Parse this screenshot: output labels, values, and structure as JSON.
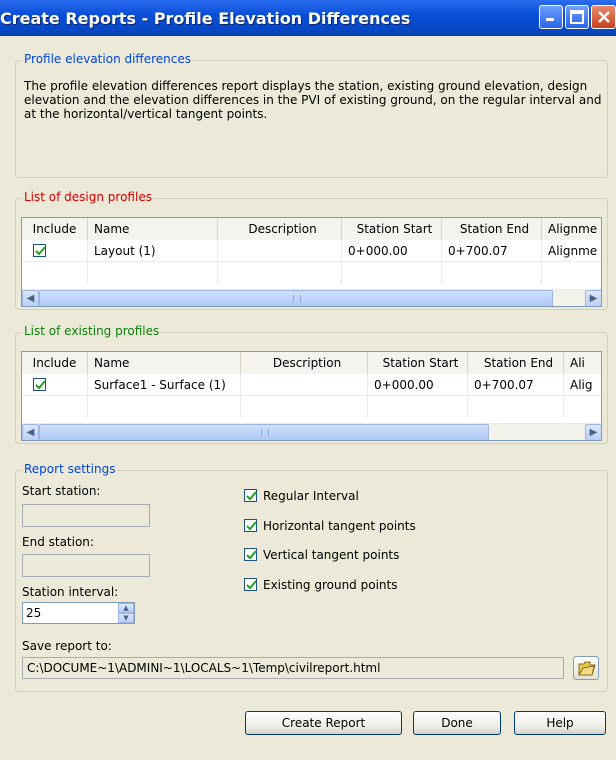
{
  "window": {
    "title": "Create Reports - Profile Elevation Differences",
    "controls": {
      "minimize": "_",
      "maximize": "□",
      "close": "X"
    }
  },
  "description_group": {
    "title": "Profile elevation differences",
    "text": "The profile elevation differences report displays the station, existing ground elevation, design elevation and the elevation differences in the PVI of existing ground, on the regular interval and at the horizontal/vertical tangent points."
  },
  "design_profiles": {
    "title": "List of design profiles",
    "columns": [
      "Include",
      "Name",
      "Description",
      "Station Start",
      "Station End",
      "Alignme"
    ],
    "rows": [
      {
        "include": true,
        "name": "Layout (1)",
        "description": "",
        "station_start": "0+000.00",
        "station_end": "0+700.07",
        "alignment": "Alignme"
      }
    ]
  },
  "existing_profiles": {
    "title": "List of existing profiles",
    "columns": [
      "Include",
      "Name",
      "Description",
      "Station Start",
      "Station End",
      "Ali"
    ],
    "rows": [
      {
        "include": true,
        "name": "Surface1 - Surface (1)",
        "description": "",
        "station_start": "0+000.00",
        "station_end": "0+700.07",
        "alignment": "Alig"
      }
    ]
  },
  "report_settings": {
    "title": "Report settings",
    "start_station_label": "Start station:",
    "start_station_value": "",
    "end_station_label": "End station:",
    "end_station_value": "",
    "interval_label": "Station interval:",
    "interval_value": "25",
    "options": [
      {
        "label": "Regular Interval",
        "checked": true
      },
      {
        "label": "Horizontal tangent points",
        "checked": true
      },
      {
        "label": "Vertical tangent points",
        "checked": true
      },
      {
        "label": "Existing ground points",
        "checked": true
      }
    ]
  },
  "save": {
    "label": "Save report to:",
    "path": "C:\\DOCUME~1\\ADMINI~1\\LOCALS~1\\Temp\\civilreport.html"
  },
  "buttons": {
    "create": "Create Report",
    "done": "Done",
    "help": "Help"
  },
  "colors": {
    "title_bar": "#0a4fd8",
    "group_blue": "#0046d5",
    "group_red": "#d80000",
    "group_green": "#0a7f0a",
    "dialog_bg": "#ece9d8"
  }
}
